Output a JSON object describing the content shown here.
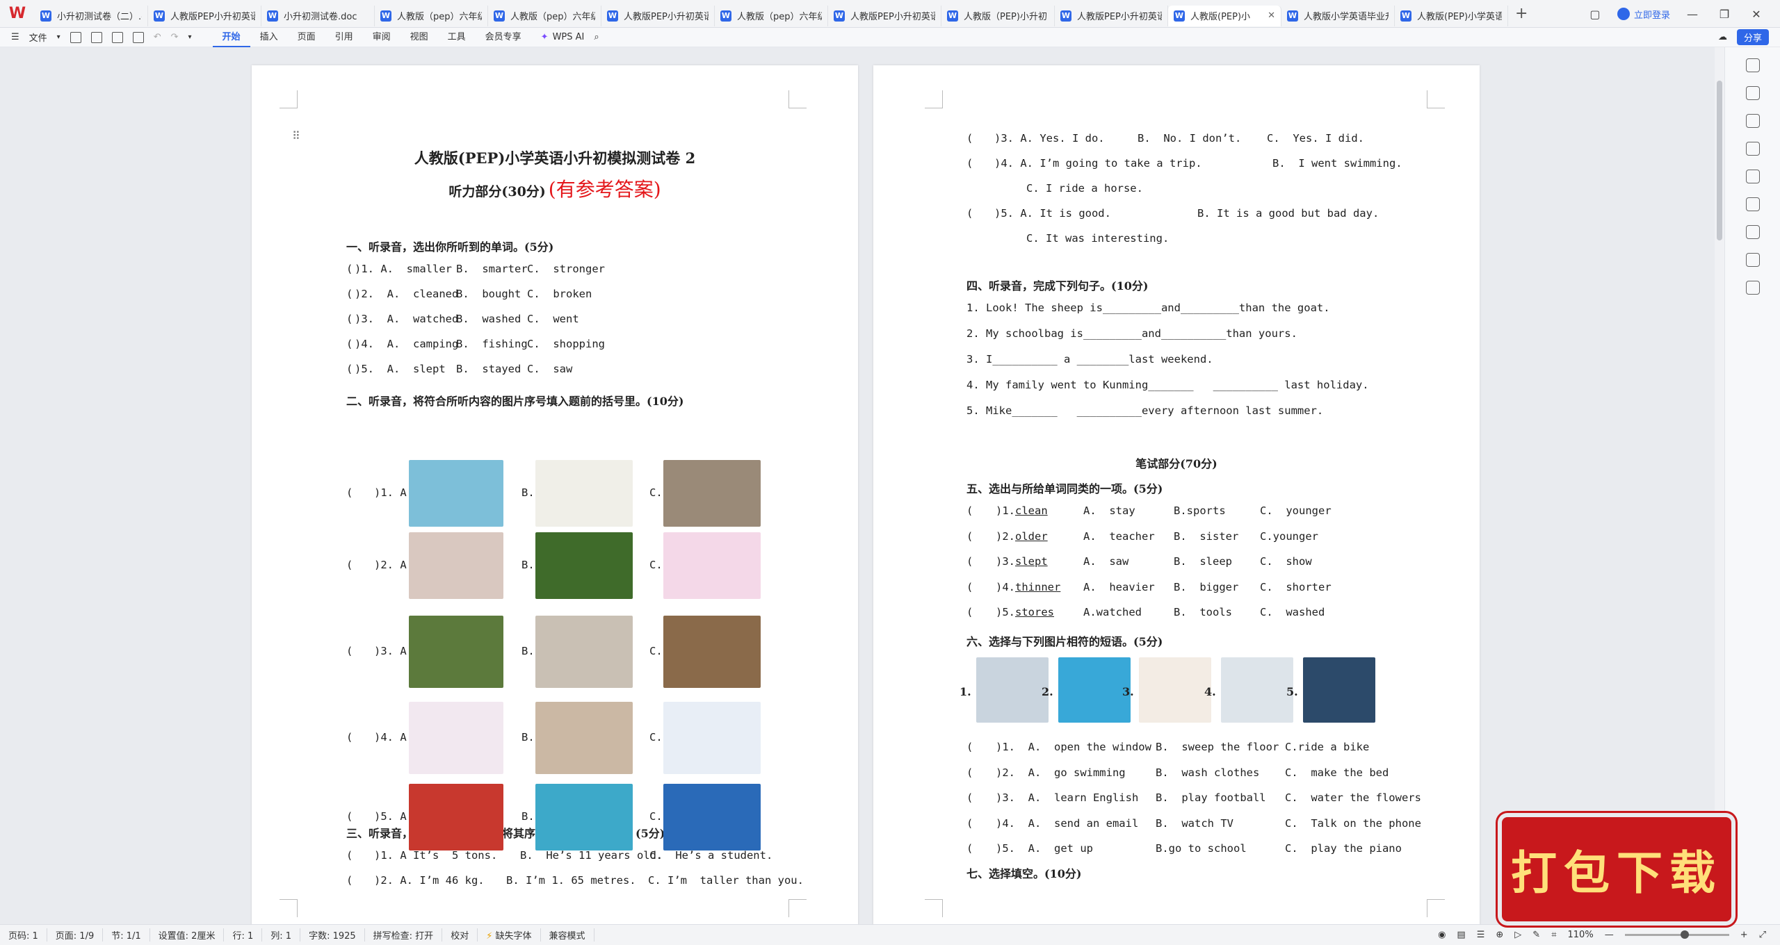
{
  "app": {
    "tabs": [
      {
        "label": "小升初测试卷（二）.d",
        "active": false
      },
      {
        "label": "人教版PEP小升初英语",
        "active": false
      },
      {
        "label": "小升初测试卷.doc",
        "active": false
      },
      {
        "label": "人教版（pep）六年级",
        "active": false
      },
      {
        "label": "人教版（pep）六年级",
        "active": false
      },
      {
        "label": "人教版PEP小升初英语",
        "active": false
      },
      {
        "label": "人教版（pep）六年级",
        "active": false
      },
      {
        "label": "人教版PEP小升初英语",
        "active": false
      },
      {
        "label": "人教版（PEP)小升初",
        "active": false
      },
      {
        "label": "人教版PEP小升初英语",
        "active": false
      },
      {
        "label": "人教版(PEP)小",
        "active": true
      },
      {
        "label": "人教版小学英语毕业升学",
        "active": false
      },
      {
        "label": "人教版(PEP)小学英语",
        "active": false
      }
    ],
    "login_label": "立即登录",
    "file_menu": "文件",
    "ribbon_tabs": [
      "开始",
      "插入",
      "页面",
      "引用",
      "审阅",
      "视图",
      "工具",
      "会员专享"
    ],
    "ribbon_active": "开始",
    "wps_ai": "WPS AI",
    "share_label": "分享",
    "colors": {
      "accent": "#2f67e8",
      "answer_red": "#e4161a",
      "stamp_red": "#c8181c"
    }
  },
  "doc": {
    "title": "人教版(PEP)小学英语小升初模拟测试卷 2",
    "subtitle": "听力部分(30分)",
    "subtitle_red": "(有参考答案)",
    "sec1": "一、听录音，选出你所听到的单词。(5分)",
    "sec1_rows": [
      [
        "(",
        ")1. A.  smaller",
        "B.  smarter",
        "C.  stronger"
      ],
      [
        "(",
        ")2.  A.  cleaned",
        "B.  bought",
        "C.  broken"
      ],
      [
        "(",
        ")3.  A.  watched",
        "B.  washed",
        "C.  went"
      ],
      [
        "(",
        ")4.  A.  camping",
        "B.  fishing",
        "C.  shopping"
      ],
      [
        "(",
        ")5.  A.  slept",
        "B.  stayed",
        "C.  saw"
      ]
    ],
    "sec2": "二、听录音，将符合所听内容的图片序号填入题前的括号里。(10分)",
    "sec2_rows": [
      {
        "num": ")1. A.",
        "b": "B.",
        "c": "C."
      },
      {
        "num": ")2. A.",
        "b": "B.",
        "c": "C."
      },
      {
        "num": ")3. A.",
        "b": "B.",
        "c": "C."
      },
      {
        "num": ")4. A.",
        "b": "B.",
        "c": "C."
      },
      {
        "num": ")5. A.",
        "b": "B.",
        "c": "C."
      }
    ],
    "sec3": "三、听录音，选择相应的答语，将其序号填入题前括号里。(5分)",
    "sec3_rows": [
      {
        "a": ")1. A It’s  5 tons.",
        "b": "B.  He’s 11 years old.",
        "c": "C.  He’s a student."
      },
      {
        "a": ")2. A. I’m 46 kg.",
        "b": "B. I’m 1. 65 metres.",
        "c": "C. I’m  taller than you."
      },
      {
        "a": ")3. A. Yes. I do.",
        "b": "B.  No. I don’t.",
        "c": "C.  Yes. I did."
      },
      {
        "a": ")4. A. I’m going to take a trip.",
        "b": "B.  I went swimming.",
        "c": "C. I ride a horse."
      },
      {
        "a": ")5. A. It is good.",
        "b": "B. It is a good but bad day.",
        "c": "C. It was interesting."
      }
    ],
    "sec4": "四、听录音，完成下列句子。(10分)",
    "sec4_rows": [
      "1. Look! The sheep is_________and_________than the goat.",
      "2. My schoolbag is_________and__________than yours.",
      "3. I__________ a ________last weekend.",
      "4. My family went to Kunming_______   __________ last holiday.",
      "5. Mike_______   __________every afternoon last summer."
    ],
    "written": "笔试部分(70分)",
    "sec5": "五、选出与所给单词同类的一项。(5分)",
    "sec5_rows": [
      {
        "n": ")1.",
        "w": "clean",
        "a": "A.  stay",
        "b": "B.sports",
        "c": "C.  younger"
      },
      {
        "n": ")2.",
        "w": "older",
        "a": "A.  teacher",
        "b": "B.  sister",
        "c": "C.younger"
      },
      {
        "n": ")3.",
        "w": "slept",
        "a": "A.  saw",
        "b": "B.  sleep",
        "c": "C.  show"
      },
      {
        "n": ")4.",
        "w": "thinner",
        "a": "A.  heavier",
        "b": "B.  bigger",
        "c": "C.  shorter"
      },
      {
        "n": ")5.",
        "w": "stores",
        "a": "A.watched",
        "b": "B.  tools",
        "c": "C.  washed"
      }
    ],
    "sec6": "六、选择与下列图片相符的短语。(5分)",
    "sec6_nums": [
      "1.",
      "2.",
      "3.",
      "4.",
      "5."
    ],
    "sec6_rows": [
      {
        "a": ")1.  A.  open the window",
        "b": "B.  sweep the floor",
        "c": "C.ride a bike"
      },
      {
        "a": ")2.  A.  go swimming",
        "b": "B.  wash clothes",
        "c": "C.  make the bed"
      },
      {
        "a": ")3.  A.  learn English",
        "b": "B.  play football",
        "c": "C.  water the flowers"
      },
      {
        "a": ")4.  A.  send an email",
        "b": "B.  watch TV",
        "c": "C.  Talk on the phone"
      },
      {
        "a": ")5.  A.  get up",
        "b": "B.go to school",
        "c": "C.  play the piano"
      }
    ],
    "sec7": "七、选择填空。(10分)",
    "paren": "("
  },
  "status": {
    "page": "页码: 1",
    "pages": "页面: 1/9",
    "section": "节: 1/1",
    "setting": "设置值: 2厘米",
    "line": "行: 1",
    "col": "列: 1",
    "words": "字数: 1925",
    "spell": "拼写检查: 打开",
    "proof": "校对",
    "font_missing": "缺失字体",
    "compat": "兼容模式",
    "zoom": "110%"
  },
  "stamp_text": "打包下载"
}
